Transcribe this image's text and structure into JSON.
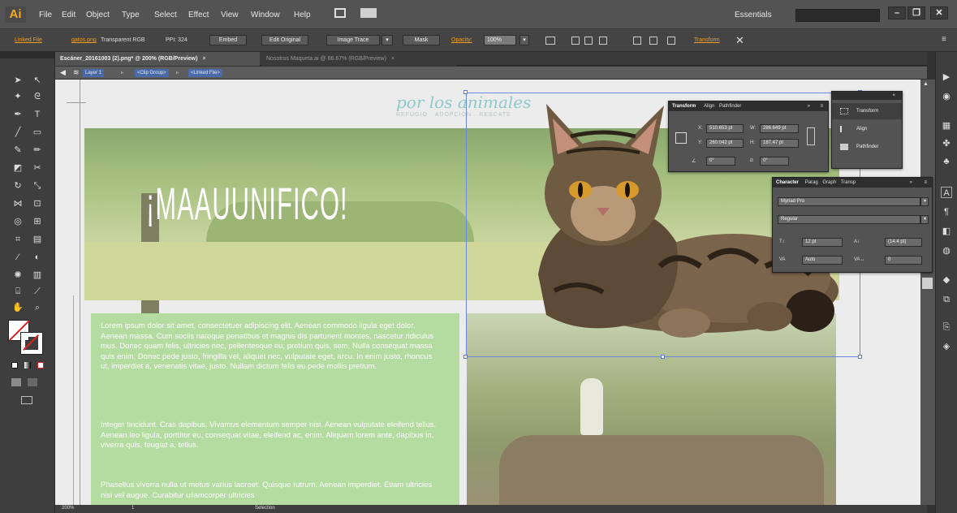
{
  "app": {
    "logo": "Ai"
  },
  "menu": [
    "File",
    "Edit",
    "Object",
    "Type",
    "Select",
    "Effect",
    "View",
    "Window",
    "Help"
  ],
  "workspace": "Essentials",
  "window_buttons": {
    "min": "–",
    "restore": "❐",
    "close": "✕"
  },
  "control": {
    "linked_file": "Linked File",
    "filename": "gatos.png",
    "color_mode": "Transparent RGB",
    "ppi": "PPI: 324",
    "embed": "Embed",
    "edit_original": "Edit Original",
    "image_trace": "Image Trace",
    "mask": "Mask",
    "opacity_label": "Opacity:",
    "opacity_value": "100%",
    "transform": "Transform"
  },
  "tabs": [
    {
      "label": "Escáner_20161003 (2).png* @ 200% (RGB/Preview)",
      "close": "×"
    },
    {
      "label": "Nosotros Maqueta.ai @ 66.67% (RGB/Preview)",
      "close": "×"
    }
  ],
  "breadcrumb": [
    "Layer 1",
    "<Clip Group>",
    "<Linked File>"
  ],
  "artwork": {
    "logo_text": "por los animales",
    "logo_sub": "REFUGIO · ADOPCIÓN · RESCATE",
    "hero_title": "¡MAAUUNIFICO!",
    "paragraphs": [
      "Lorem ipsum dolor sit amet, consectetuer adipiscing elit. Aenean commodo ligula eget dolor. Aenean massa. Cum sociis natoque penatibus et magnis dis parturient montes, nascetur ridiculus mus. Donec quam felis, ultricies nec, pellentesque eu, pretium quis, sem. Nulla consequat massa quis enim. Donec pede justo, fringilla vel, aliquet nec, vulputate eget, arcu. In enim justo, rhoncus ut, imperdiet a, venenatis vitae, justo. Nullam dictum felis eu pede mollis pretium.",
      "Integer tincidunt. Cras dapibus. Vivamus elementum semper nisi. Aenean vulputate eleifend tellus. Aenean leo ligula, porttitor eu, consequat vitae, eleifend ac, enim. Aliquam lorem ante, dapibus in, viverra quis, feugiat a, tellus.",
      "Phasellus viverra nulla ut metus varius laoreet. Quisque rutrum. Aenean imperdiet. Etiam ultricies nisi vel augue. Curabitur ullamcorper ultricies"
    ]
  },
  "transform_panel": {
    "tabs": [
      "Transform",
      "Align",
      "Pathfinder"
    ],
    "x_label": "X:",
    "x": "510.653 pt",
    "y_label": "Y:",
    "y": "260.042 pt",
    "w_label": "W:",
    "w": "286.649 pt",
    "h_label": "H:",
    "h": "187.47 pt",
    "angle": "0°",
    "shear": "0°"
  },
  "mini_panel": {
    "items": [
      "Transform",
      "Align",
      "Pathfinder"
    ]
  },
  "character_panel": {
    "tabs": [
      "Character",
      "Parag",
      "Graph",
      "Transp"
    ],
    "font": "Myriad Pro",
    "style": "Regular",
    "size": "12 pt",
    "leading": "(14.4 pt)",
    "kerning": "Auto",
    "tracking": "0"
  },
  "status": {
    "zoom": "200%",
    "page": "1",
    "tool": "Selection"
  }
}
